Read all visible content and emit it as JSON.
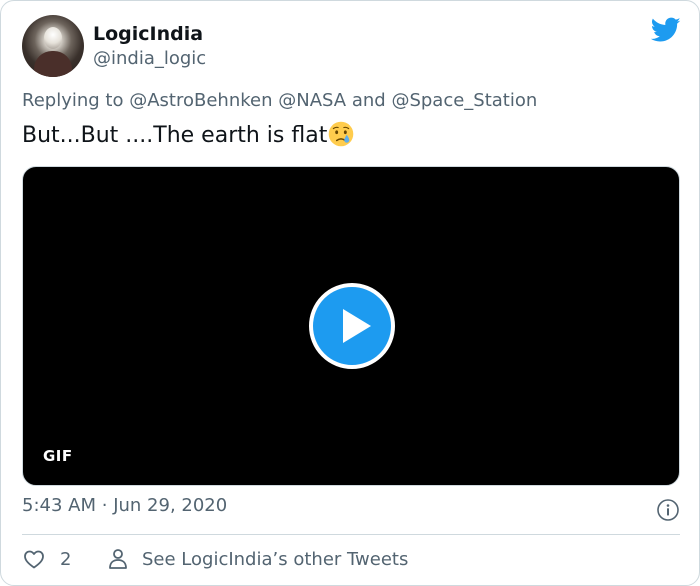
{
  "author": {
    "display_name": "LogicIndia",
    "handle": "@india_logic",
    "avatar_icon": "profile-photo"
  },
  "brand": {
    "icon": "twitter-bird-icon",
    "color": "#1d9bf0"
  },
  "reply": {
    "prefix": "Replying to",
    "mentions": [
      "@AstroBehnken",
      "@NASA",
      "@Space_Station"
    ],
    "conjunction": "and"
  },
  "tweet": {
    "text": "But...But ....The earth is flat",
    "emoji": "crying-face"
  },
  "media": {
    "badge": "GIF",
    "play_icon": "play-icon"
  },
  "meta": {
    "time": "5:43 AM",
    "separator": "·",
    "date": "Jun 29, 2020"
  },
  "actions": {
    "like_count": "2",
    "see_other_label": "See LogicIndia’s other Tweets"
  },
  "colors": {
    "text_primary": "#0f1419",
    "text_secondary": "#536471",
    "border": "#cfd9de"
  }
}
